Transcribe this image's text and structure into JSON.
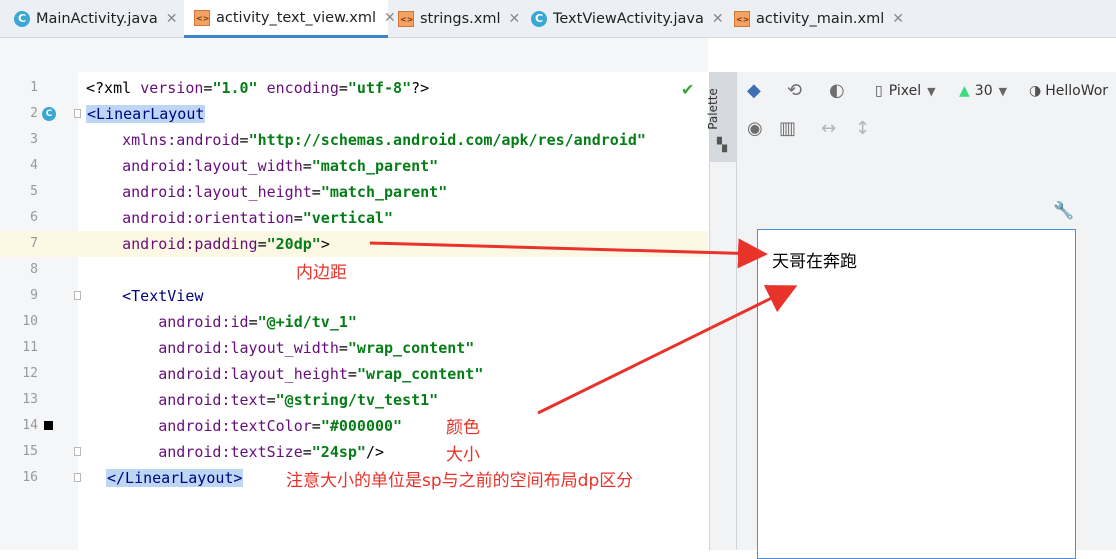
{
  "tabs": [
    {
      "label": "MainActivity.java",
      "type": "java",
      "active": false
    },
    {
      "label": "activity_text_view.xml",
      "type": "xml",
      "active": true
    },
    {
      "label": "strings.xml",
      "type": "xml",
      "active": false
    },
    {
      "label": "TextViewActivity.java",
      "type": "java",
      "active": false
    },
    {
      "label": "activity_main.xml",
      "type": "xml",
      "active": false
    }
  ],
  "tab_close": "✕",
  "java_glyph": "C",
  "line_numbers": [
    "1",
    "2",
    "3",
    "4",
    "5",
    "6",
    "7",
    "8",
    "9",
    "10",
    "11",
    "12",
    "13",
    "14",
    "15",
    "16"
  ],
  "code": {
    "l1_tag_open": "<?xml ",
    "l1_a1": "version",
    "l1_eq1": "=",
    "l1_v1": "\"1.0\"",
    "l1_a2": "encoding",
    "l1_eq2": "=",
    "l1_v2": "\"utf-8\"",
    "l1_tag_close": "?>",
    "l2_tag": "<LinearLayout",
    "l3_attr": "xmlns:android",
    "l3_val": "\"http://schemas.android.com/apk/res/android\"",
    "l4_attr": "android:layout_width",
    "l4_val": "\"match_parent\"",
    "l5_attr": "android:layout_height",
    "l5_val": "\"match_parent\"",
    "l6_attr": "android:orientation",
    "l6_val": "\"vertical\"",
    "l7_attr": "android:padding",
    "l7_val": "\"20dp\"",
    "l7_close": ">",
    "l9_tag": "<TextView",
    "l10_attr": "android:id",
    "l10_val": "\"@+id/tv_1\"",
    "l11_attr": "android:layout_width",
    "l11_val": "\"wrap_content\"",
    "l12_attr": "android:layout_height",
    "l12_val": "\"wrap_content\"",
    "l13_attr": "android:text",
    "l13_val": "\"@string/tv_test1\"",
    "l14_attr": "android:textColor",
    "l14_val": "\"#000000\"",
    "l15_attr": "android:textSize",
    "l15_val": "\"24sp\"",
    "l15_close": "/>",
    "l16_tag": "</LinearLayout>",
    "eq": "="
  },
  "annotations": {
    "padding": "内边距",
    "color": "颜色",
    "size": "大小",
    "unit_note": "注意大小的单位是sp与之前的空间布局dp区分"
  },
  "designer": {
    "palette_label": "Palette",
    "device": "Pixel",
    "api": "30",
    "theme": "HelloWor",
    "preview_text": "天哥在奔跑"
  },
  "colors": {
    "annotation": "#e8332b",
    "selection": "#4a90d9",
    "attr": "#660e7a",
    "value": "#067d17",
    "tag": "#000080"
  }
}
